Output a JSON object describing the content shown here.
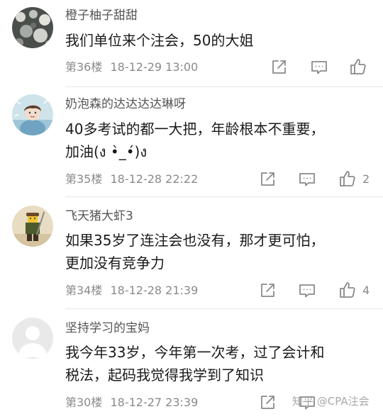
{
  "comments": [
    {
      "username": "橙子柚子甜甜",
      "lines": [
        "我们单位来个注会，50的大姐"
      ],
      "floor": "第36楼",
      "time": "18-12-29 13:00",
      "likes": ""
    },
    {
      "username": "奶泡森的达达达达琳呀",
      "lines": [
        "40多考试的都一大把，年龄根本不重要，",
        "加油(ง •̀_•́)ง"
      ],
      "floor": "第35楼",
      "time": "18-12-28 22:22",
      "likes": "2"
    },
    {
      "username": "飞天猪大虾3",
      "lines": [
        "如果35岁了连注会也没有，那才更可怕，",
        "更加没有竞争力"
      ],
      "floor": "第34楼",
      "time": "18-12-28 21:39",
      "likes": "4"
    },
    {
      "username": "坚持学习的宝妈",
      "lines": [
        "我今年33岁，今年第一次考，过了会计和",
        "税法，起码我觉得我学到了知识"
      ],
      "floor": "第30楼",
      "time": "18-12-27 23:39",
      "likes": ""
    }
  ],
  "watermark": "知乎 @CPA注会",
  "icons": {
    "share": "share-icon",
    "comment": "comment-icon",
    "like": "thumbs-up-icon"
  },
  "colors": {
    "username": "#555555",
    "content": "#1a1a1a",
    "meta": "#8a8a8a",
    "divider": "#e6e6e6"
  }
}
